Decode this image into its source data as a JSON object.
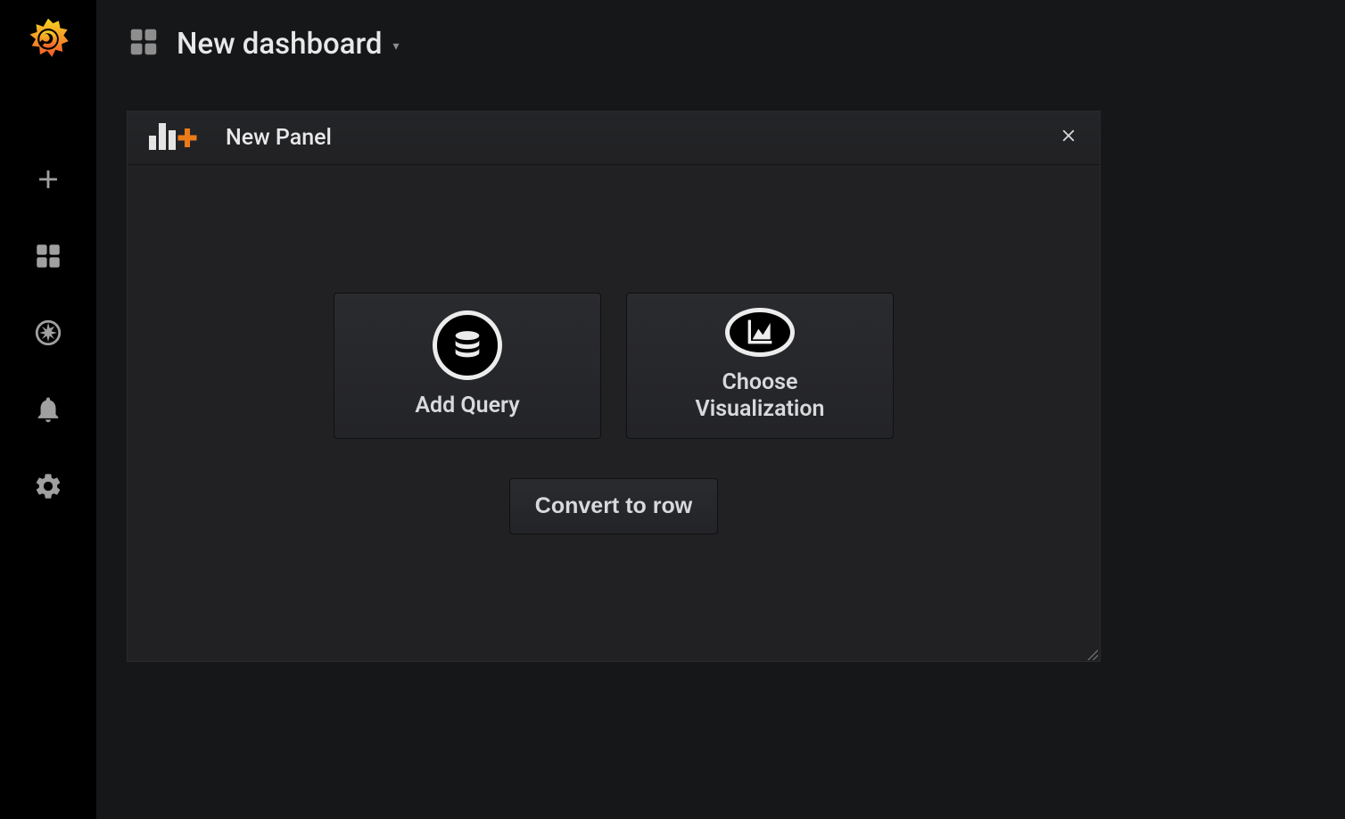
{
  "sidebar": {
    "items": [
      {
        "name": "create"
      },
      {
        "name": "dashboards"
      },
      {
        "name": "explore"
      },
      {
        "name": "alerting"
      },
      {
        "name": "configuration"
      }
    ]
  },
  "header": {
    "title": "New dashboard"
  },
  "panel": {
    "title": "New Panel",
    "actions": {
      "add_query": "Add Query",
      "choose_viz": "Choose\nVisualization",
      "convert_row": "Convert to row"
    }
  }
}
